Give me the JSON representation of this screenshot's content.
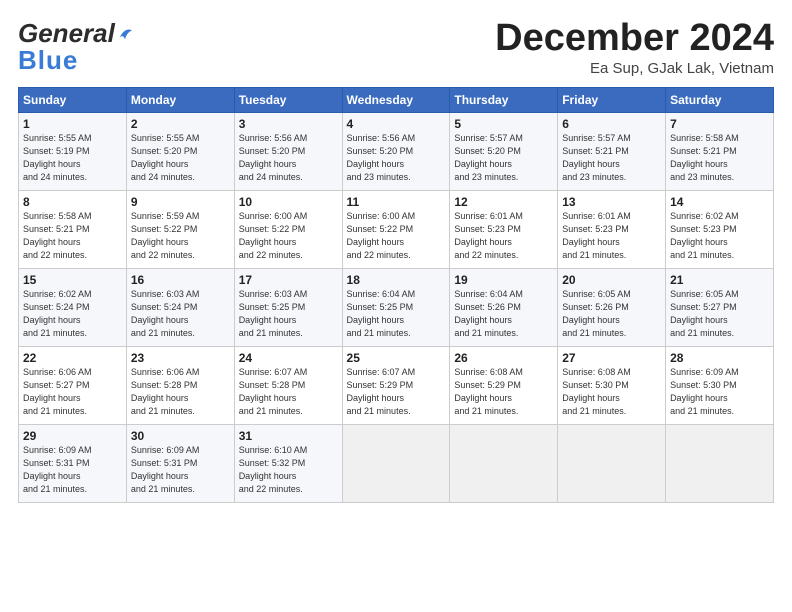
{
  "header": {
    "logo": {
      "line1": "General",
      "line2": "Blue"
    },
    "title": "December 2024",
    "location": "Ea Sup, GJak Lak, Vietnam"
  },
  "calendar": {
    "days_of_week": [
      "Sunday",
      "Monday",
      "Tuesday",
      "Wednesday",
      "Thursday",
      "Friday",
      "Saturday"
    ],
    "weeks": [
      [
        {
          "day": "1",
          "sunrise": "5:55 AM",
          "sunset": "5:19 PM",
          "daylight": "11 hours and 24 minutes."
        },
        {
          "day": "2",
          "sunrise": "5:55 AM",
          "sunset": "5:20 PM",
          "daylight": "11 hours and 24 minutes."
        },
        {
          "day": "3",
          "sunrise": "5:56 AM",
          "sunset": "5:20 PM",
          "daylight": "11 hours and 24 minutes."
        },
        {
          "day": "4",
          "sunrise": "5:56 AM",
          "sunset": "5:20 PM",
          "daylight": "11 hours and 23 minutes."
        },
        {
          "day": "5",
          "sunrise": "5:57 AM",
          "sunset": "5:20 PM",
          "daylight": "11 hours and 23 minutes."
        },
        {
          "day": "6",
          "sunrise": "5:57 AM",
          "sunset": "5:21 PM",
          "daylight": "11 hours and 23 minutes."
        },
        {
          "day": "7",
          "sunrise": "5:58 AM",
          "sunset": "5:21 PM",
          "daylight": "11 hours and 23 minutes."
        }
      ],
      [
        {
          "day": "8",
          "sunrise": "5:58 AM",
          "sunset": "5:21 PM",
          "daylight": "11 hours and 22 minutes."
        },
        {
          "day": "9",
          "sunrise": "5:59 AM",
          "sunset": "5:22 PM",
          "daylight": "11 hours and 22 minutes."
        },
        {
          "day": "10",
          "sunrise": "6:00 AM",
          "sunset": "5:22 PM",
          "daylight": "11 hours and 22 minutes."
        },
        {
          "day": "11",
          "sunrise": "6:00 AM",
          "sunset": "5:22 PM",
          "daylight": "11 hours and 22 minutes."
        },
        {
          "day": "12",
          "sunrise": "6:01 AM",
          "sunset": "5:23 PM",
          "daylight": "11 hours and 22 minutes."
        },
        {
          "day": "13",
          "sunrise": "6:01 AM",
          "sunset": "5:23 PM",
          "daylight": "11 hours and 21 minutes."
        },
        {
          "day": "14",
          "sunrise": "6:02 AM",
          "sunset": "5:23 PM",
          "daylight": "11 hours and 21 minutes."
        }
      ],
      [
        {
          "day": "15",
          "sunrise": "6:02 AM",
          "sunset": "5:24 PM",
          "daylight": "11 hours and 21 minutes."
        },
        {
          "day": "16",
          "sunrise": "6:03 AM",
          "sunset": "5:24 PM",
          "daylight": "11 hours and 21 minutes."
        },
        {
          "day": "17",
          "sunrise": "6:03 AM",
          "sunset": "5:25 PM",
          "daylight": "11 hours and 21 minutes."
        },
        {
          "day": "18",
          "sunrise": "6:04 AM",
          "sunset": "5:25 PM",
          "daylight": "11 hours and 21 minutes."
        },
        {
          "day": "19",
          "sunrise": "6:04 AM",
          "sunset": "5:26 PM",
          "daylight": "11 hours and 21 minutes."
        },
        {
          "day": "20",
          "sunrise": "6:05 AM",
          "sunset": "5:26 PM",
          "daylight": "11 hours and 21 minutes."
        },
        {
          "day": "21",
          "sunrise": "6:05 AM",
          "sunset": "5:27 PM",
          "daylight": "11 hours and 21 minutes."
        }
      ],
      [
        {
          "day": "22",
          "sunrise": "6:06 AM",
          "sunset": "5:27 PM",
          "daylight": "11 hours and 21 minutes."
        },
        {
          "day": "23",
          "sunrise": "6:06 AM",
          "sunset": "5:28 PM",
          "daylight": "11 hours and 21 minutes."
        },
        {
          "day": "24",
          "sunrise": "6:07 AM",
          "sunset": "5:28 PM",
          "daylight": "11 hours and 21 minutes."
        },
        {
          "day": "25",
          "sunrise": "6:07 AM",
          "sunset": "5:29 PM",
          "daylight": "11 hours and 21 minutes."
        },
        {
          "day": "26",
          "sunrise": "6:08 AM",
          "sunset": "5:29 PM",
          "daylight": "11 hours and 21 minutes."
        },
        {
          "day": "27",
          "sunrise": "6:08 AM",
          "sunset": "5:30 PM",
          "daylight": "11 hours and 21 minutes."
        },
        {
          "day": "28",
          "sunrise": "6:09 AM",
          "sunset": "5:30 PM",
          "daylight": "11 hours and 21 minutes."
        }
      ],
      [
        {
          "day": "29",
          "sunrise": "6:09 AM",
          "sunset": "5:31 PM",
          "daylight": "11 hours and 21 minutes."
        },
        {
          "day": "30",
          "sunrise": "6:09 AM",
          "sunset": "5:31 PM",
          "daylight": "11 hours and 21 minutes."
        },
        {
          "day": "31",
          "sunrise": "6:10 AM",
          "sunset": "5:32 PM",
          "daylight": "11 hours and 22 minutes."
        },
        null,
        null,
        null,
        null
      ]
    ]
  }
}
